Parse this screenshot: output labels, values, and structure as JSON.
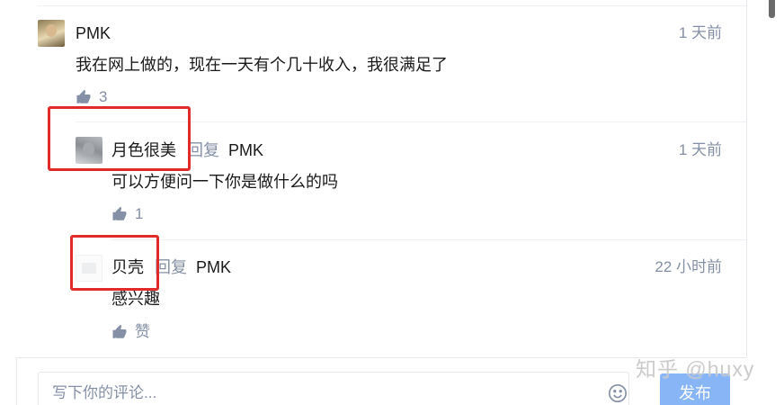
{
  "comments": [
    {
      "author": "PMK",
      "time": "1 天前",
      "text": "我在网上做的，现在一天有个几十收入，我很满足了",
      "likes": "3"
    },
    {
      "author": "月色很美",
      "reply_word": "回复",
      "reply_to": "PMK",
      "time": "1 天前",
      "text": "可以方便问一下你是做什么的吗",
      "likes": "1"
    },
    {
      "author": "贝壳",
      "reply_word": "回复",
      "reply_to": "PMK",
      "time": "22 小时前",
      "text": "感兴趣",
      "likes": "赞"
    }
  ],
  "composer": {
    "placeholder": "写下你的评论...",
    "submit_label": "发布"
  },
  "watermark": "知乎 @huxy",
  "icons": {
    "like": "thumbs-up-icon",
    "emoji": "smile-icon"
  },
  "colors": {
    "text": "#1a1a1a",
    "meta_gray": "#8590a6",
    "submit_button": "#88b5f6",
    "highlight_red": "#e12b2b"
  }
}
